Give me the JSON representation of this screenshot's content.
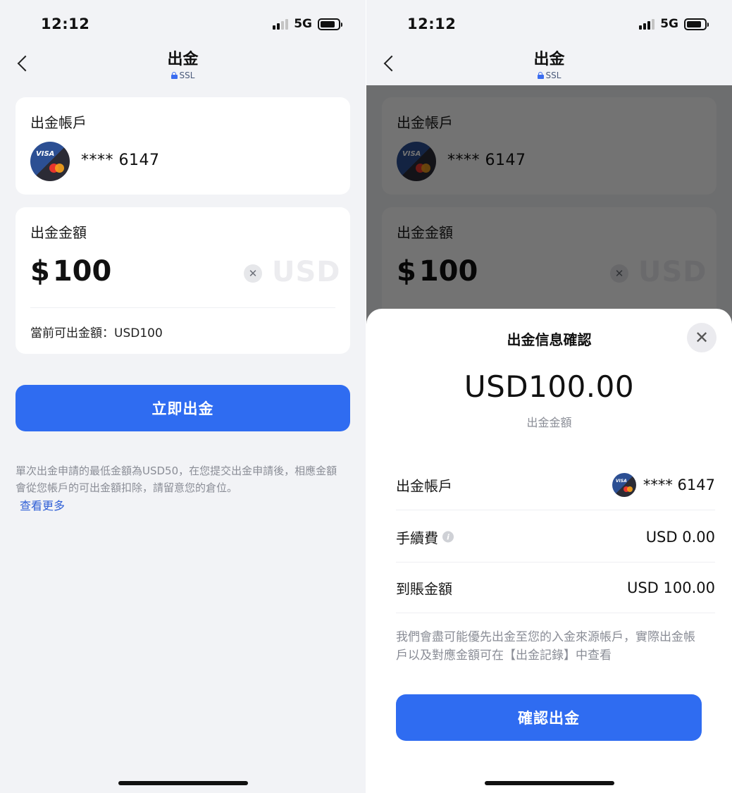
{
  "status": {
    "time": "12:12",
    "network": "5G"
  },
  "nav": {
    "title": "出金",
    "ssl": "SSL"
  },
  "account": {
    "label": "出金帳戶",
    "masked_number": "**** 6147",
    "card_brand_visa": "VISA"
  },
  "amount": {
    "label": "出金金額",
    "symbol": "$",
    "value": "100",
    "currency": "USD",
    "clear_glyph": "✕",
    "available_text": "當前可出金額：USD100"
  },
  "actions": {
    "withdraw_now": "立即出金"
  },
  "notice": {
    "text": "單次出金申請的最低金額為USD50，在您提交出金申請後，相應金額會從您帳戶的可出金額扣除，請留意您的倉位。",
    "more_link": "查看更多"
  },
  "confirm_sheet": {
    "title": "出金信息確認",
    "close_glyph": "✕",
    "amount": "USD100.00",
    "amount_label": "出金金額",
    "rows": [
      {
        "label": "出金帳戶",
        "value": "**** 6147"
      },
      {
        "label": "手續費",
        "value": "USD 0.00"
      },
      {
        "label": "到賬金額",
        "value": "USD 100.00"
      }
    ],
    "notice": "我們會盡可能優先出金至您的入金來源帳戶，實際出金帳戶以及對應金額可在【出金記錄】中查看",
    "confirm_button": "確認出金"
  },
  "icons": {
    "back": "chevron-left-icon",
    "lock": "lock-icon",
    "card": "visa-mastercard-icon",
    "clear": "clear-icon",
    "close": "close-icon",
    "info": "info-icon"
  },
  "colors": {
    "primary": "#2f6cf1",
    "background": "#f2f3f6",
    "link": "#2f5fd6",
    "muted_text": "#8a8d96"
  }
}
